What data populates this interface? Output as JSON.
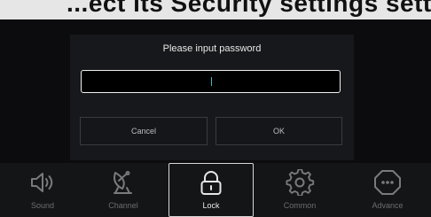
{
  "banner": {
    "text": "...ect its Security settings settings"
  },
  "dialog": {
    "title": "Please input password",
    "password_value": "",
    "cancel_label": "Cancel",
    "ok_label": "OK"
  },
  "nav": {
    "items": [
      {
        "label": "Sound",
        "icon": "speaker-icon",
        "active": false
      },
      {
        "label": "Channel",
        "icon": "satellite-dish-icon",
        "active": false
      },
      {
        "label": "Lock",
        "icon": "padlock-icon",
        "active": true
      },
      {
        "label": "Common",
        "icon": "gear-icon",
        "active": false
      },
      {
        "label": "Advance",
        "icon": "more-options-icon",
        "active": false
      }
    ]
  },
  "colors": {
    "background": "#0c0c0e",
    "dialog_bg": "#17181b",
    "nav_bar_bg": "#141517",
    "caret": "#3fb6c8",
    "active_text": "#e8e8e8",
    "inactive_text": "#6d6d70"
  }
}
